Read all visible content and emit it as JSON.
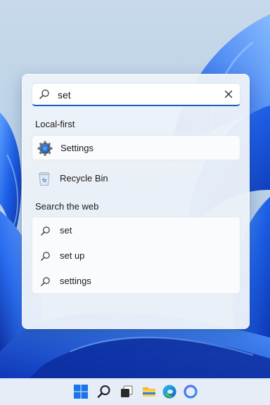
{
  "search": {
    "query": "set",
    "clear_icon": "close-icon",
    "search_icon": "search-icon"
  },
  "sections": {
    "local_heading": "Local-first",
    "web_heading": "Search the web"
  },
  "local_results": [
    {
      "label": "Settings",
      "icon": "settings-gear-icon"
    },
    {
      "label": "Recycle Bin",
      "icon": "recycle-bin-icon"
    }
  ],
  "web_results": [
    {
      "label": "set",
      "icon": "search-icon"
    },
    {
      "label": "set up",
      "icon": "search-icon"
    },
    {
      "label": "settings",
      "icon": "search-icon"
    }
  ],
  "taskbar": {
    "items": [
      "windows-start-icon",
      "search-icon",
      "task-view-icon",
      "file-explorer-icon",
      "edge-browser-icon",
      "cortana-ring-icon"
    ]
  },
  "colors": {
    "accent": "#1a5fb4",
    "wallpaper_blue": "#1e5fe0",
    "panel_bg": "#ecf1f8"
  }
}
